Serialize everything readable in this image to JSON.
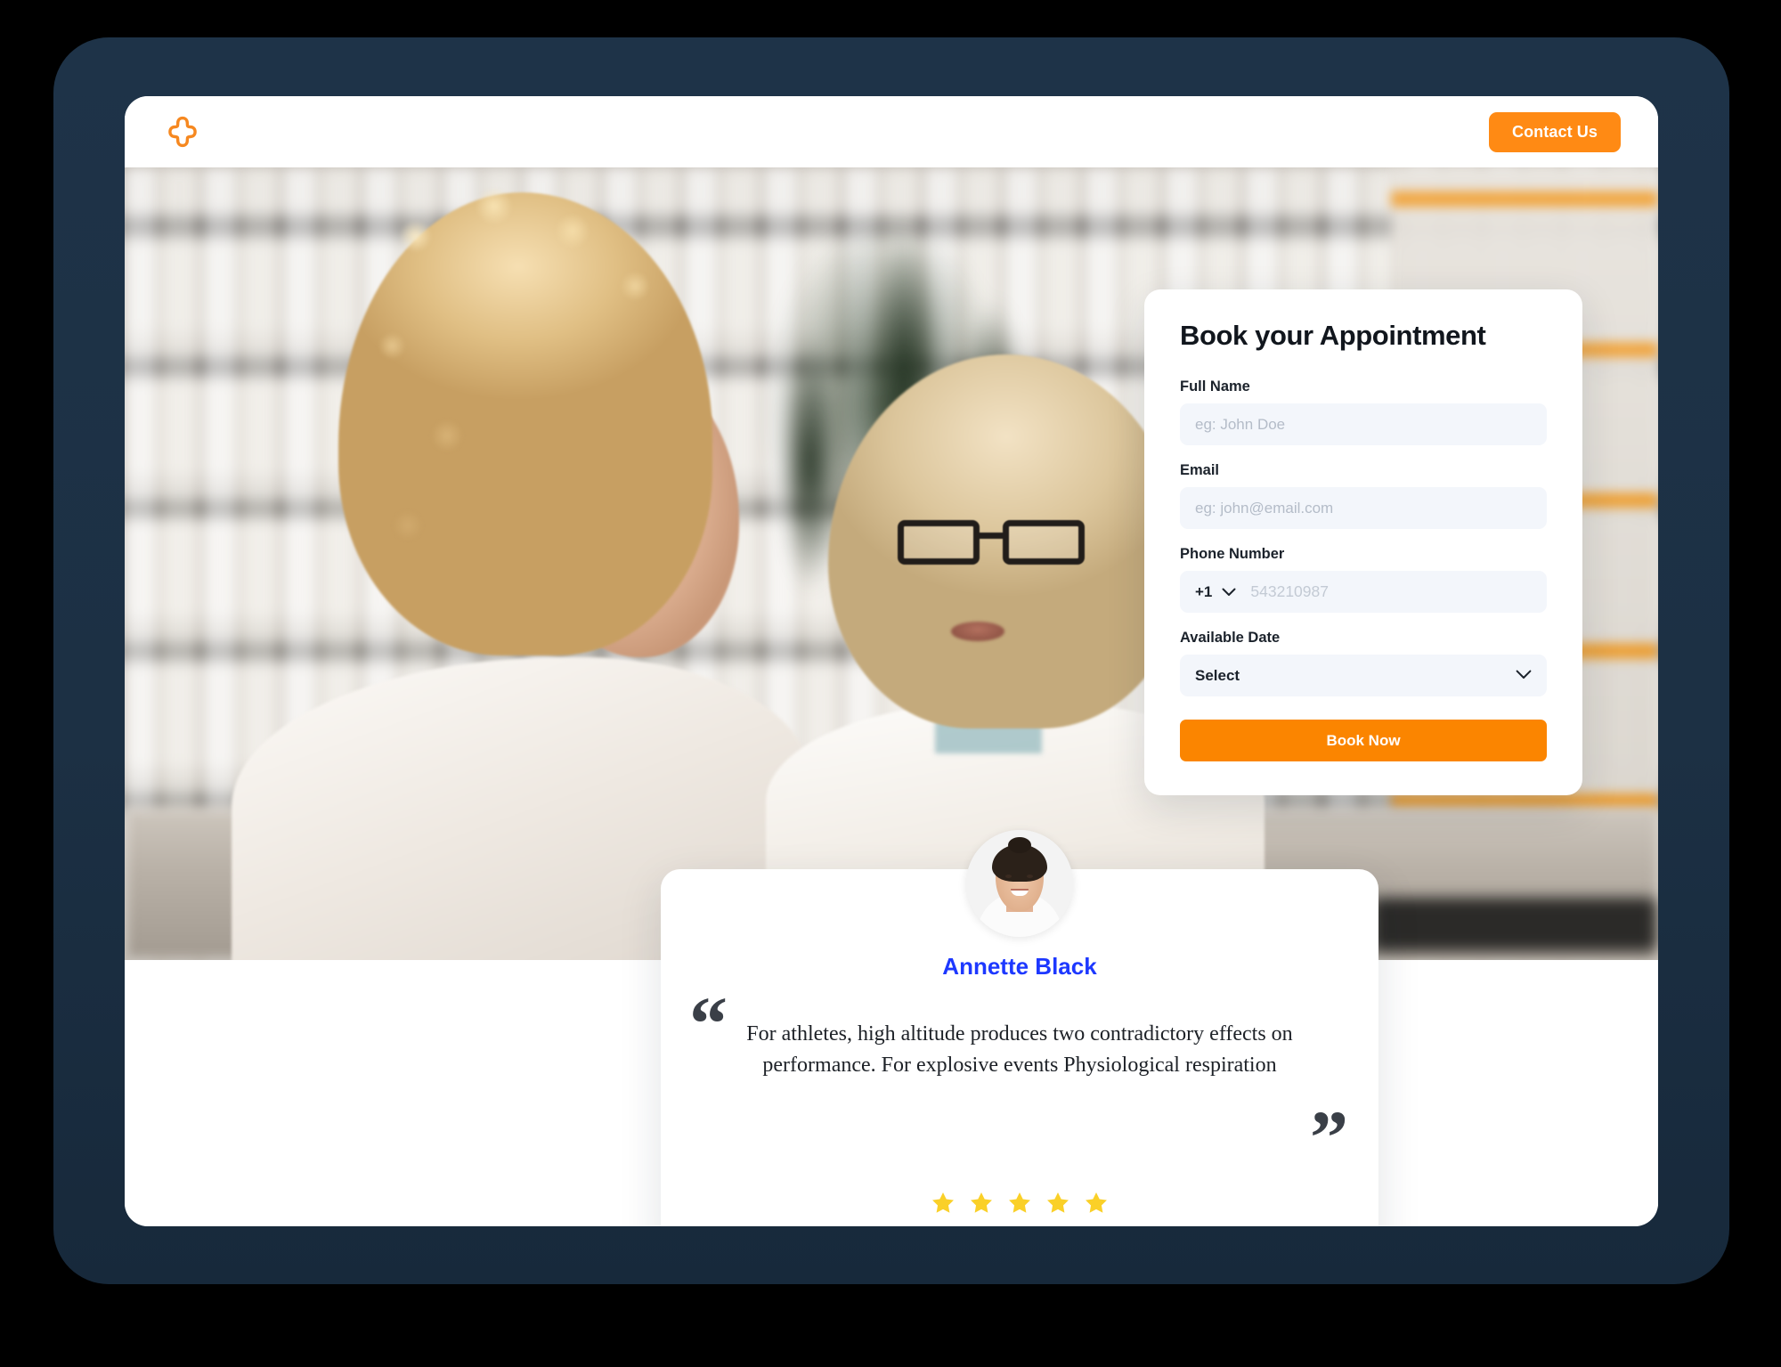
{
  "theme": {
    "accent_orange": "#FB8500",
    "header_button_orange": "#FF8A14",
    "bezel_navy": "#1E3348",
    "link_blue": "#1D38FF",
    "star_gold": "#FAD028",
    "input_bg": "#F3F6FB",
    "page_bg": "#FFFFFF"
  },
  "header": {
    "logo_icon": "medical-cross-icon",
    "contact_label": "Contact Us"
  },
  "hero": {
    "alt": "Pharmacist in white coat consulting a customer in a pharmacy aisle"
  },
  "booking_form": {
    "title": "Book your Appointment",
    "fields": [
      {
        "label": "Full Name",
        "placeholder": "eg: John Doe",
        "value": ""
      },
      {
        "label": "Email",
        "placeholder": "eg: john@email.com",
        "value": ""
      }
    ],
    "phone": {
      "label": "Phone Number",
      "country_code": "+1",
      "placeholder": "543210987",
      "value": "",
      "caret_icon": "chevron-down-icon"
    },
    "available_date": {
      "label": "Available Date",
      "selected": "Select",
      "caret_icon": "chevron-down-icon"
    },
    "submit_label": "Book Now"
  },
  "testimonial": {
    "avatar_icon": "user-avatar-photo",
    "name": "Annette Black",
    "quote_open": "“",
    "quote_close": "”",
    "quote": "For athletes, high altitude produces two contradictory effects on performance. For explosive events Physiological respiration",
    "rating": 5,
    "rating_max": 5,
    "star_icon": "star-filled-icon"
  }
}
